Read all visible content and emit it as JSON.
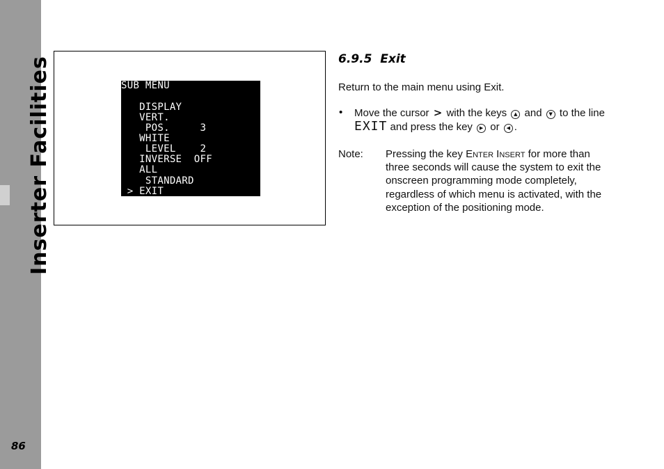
{
  "sidebar": {
    "chapter_title": "Inserter Facilities",
    "page_number": "86"
  },
  "figure": {
    "osd_lines": [
      {
        "text": "SUB MENU"
      },
      {
        "text": ""
      },
      {
        "text": "   DISPLAY"
      },
      {
        "text": "   VERT."
      },
      {
        "text": "    POS.     3"
      },
      {
        "text": "   WHITE"
      },
      {
        "text": "    LEVEL    2"
      },
      {
        "text": "   INVERSE  OFF"
      },
      {
        "text": "   ALL"
      },
      {
        "text": "    STANDARD"
      },
      {
        "text": " > EXIT"
      }
    ]
  },
  "section": {
    "heading": "6.9.5  Exit",
    "intro": "Return to the main menu using Exit.",
    "bullet": {
      "marker": "•",
      "line1_a": "Move the cursor",
      "cursor_symbol": ">",
      "line1_b": "with the keys",
      "key_up": "▲",
      "line1_c": "and",
      "key_down": "▼",
      "line1_d": "to the line",
      "exit_word": "EXIT",
      "line2_a": "and press the key",
      "key_right": "▶",
      "line2_b": "or",
      "key_left": "◀",
      "line2_end": "."
    },
    "note": {
      "label": "Note:",
      "line1_a": "Pressing the key",
      "key_name": "Enter Insert",
      "line1_b": "for more than",
      "line2": "three seconds will cause the system to exit the",
      "line3": "onscreen programming mode completely,",
      "line4": "regardless of which menu is activated, with the",
      "line5": "exception of the positioning mode."
    }
  }
}
